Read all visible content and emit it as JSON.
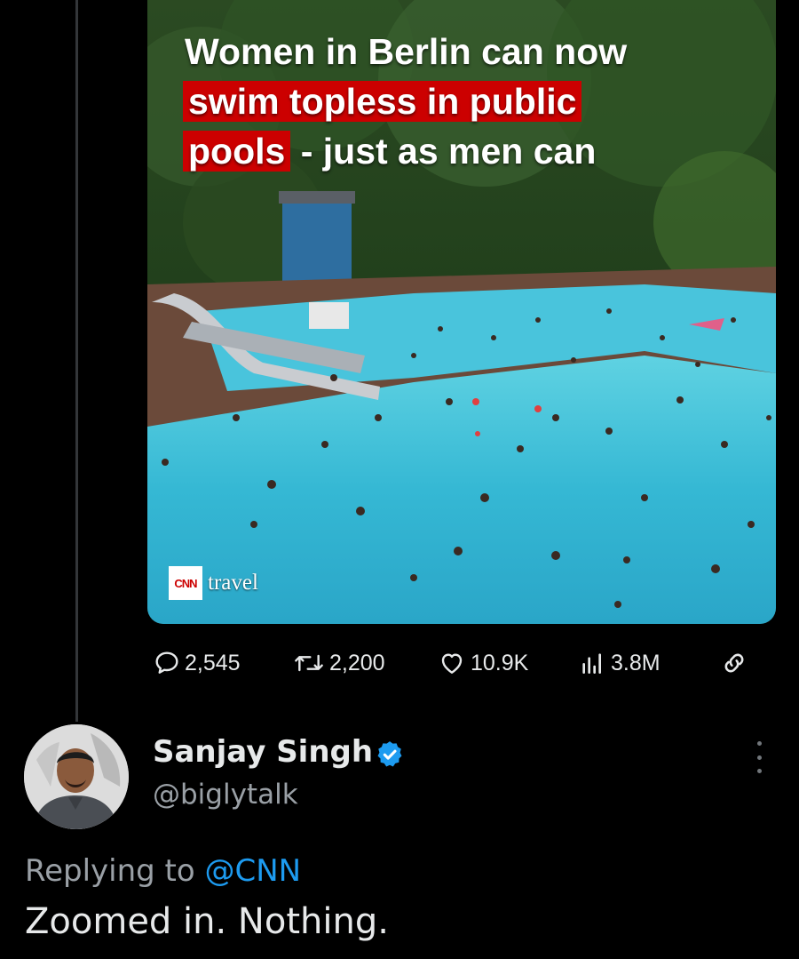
{
  "post": {
    "media": {
      "headline_line1": "Women in Berlin can now",
      "headline_line2_highlight": "swim topless in public",
      "headline_line3_highlight": "pools",
      "headline_line3_rest": " - just as men can",
      "brand_logo": "CNN",
      "brand_text": "travel",
      "highlight_color": "#cc0000"
    },
    "actions": {
      "replies": "2,545",
      "reposts": "2,200",
      "likes": "10.9K",
      "views": "3.8M"
    }
  },
  "reply": {
    "author_name": "Sanjay Singh",
    "handle": "@biglytalk",
    "replying_prefix": "Replying to ",
    "replying_mention": "@CNN",
    "text": "Zoomed in. Nothing."
  },
  "colors": {
    "accent": "#1d9bf0",
    "background": "#000000",
    "secondary_text": "#9aa0a6"
  },
  "icons": [
    "reply-icon",
    "repost-icon",
    "like-icon",
    "views-icon",
    "share-icon",
    "verified-badge-icon",
    "more-icon"
  ]
}
